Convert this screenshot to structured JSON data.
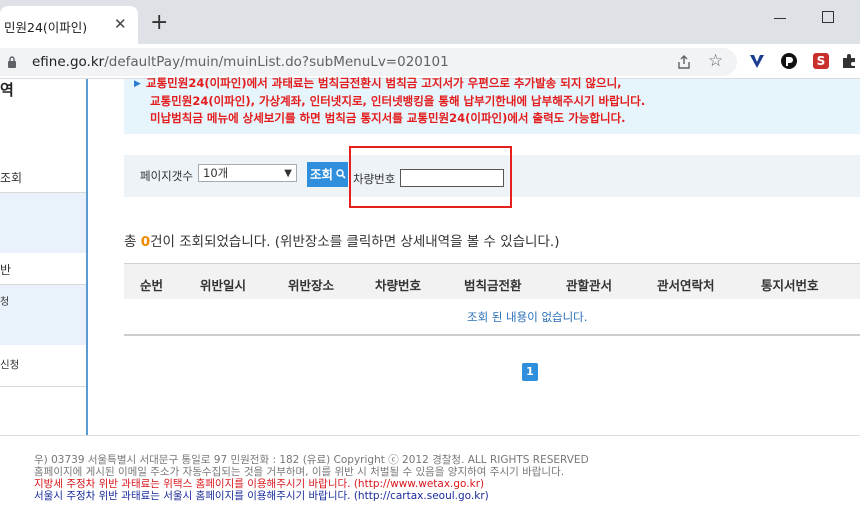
{
  "browser": {
    "tab_title": "민원24(이파인)",
    "tab_close": "✕",
    "new_tab": "+",
    "url_host": "efine.go.kr",
    "url_path": "/defaultPay/muin/muinList.do?subMenuLv=020101",
    "star": "☆"
  },
  "sidebar": {
    "title": "역",
    "items": [
      "조회",
      "반",
      "청",
      "신청"
    ]
  },
  "notice": {
    "line1": "교통민원24(이파인)에서 과태료는 범칙금전환시 범칙금 고지서가 우편으로 추가발송 되지 않으니,",
    "line2": "교통민원24(이파인), 가상계좌, 인터넷지로, 인터넷뱅킹을 통해 납부기한내에 납부해주시기 바랍니다.",
    "line3": "미납범칙금 메뉴에 상세보기를 하면 범칙금 통지서를 교통민원24(이파인)에서 출력도 가능합니다.",
    "arrow": "▶"
  },
  "search": {
    "page_count_label": "페이지갯수",
    "page_count_value": "10개",
    "search_button": "조회",
    "car_number_label": "차량번호",
    "car_number_value": ""
  },
  "result": {
    "prefix": "총 ",
    "count": "0",
    "suffix": "건이 조회되었습니다. (위반장소를 클릭하면 상세내역을 볼 수 있습니다.)"
  },
  "table": {
    "columns": [
      "순번",
      "위반일시",
      "위반장소",
      "차량번호",
      "범칙금전환",
      "관할관서",
      "관서연락처",
      "통지서번호"
    ],
    "empty_message": "조회 된 내용이 없습니다."
  },
  "pagination": {
    "current": "1"
  },
  "footer": {
    "line1": "우) 03739 서울특별시 서대문구 통일로 97   민원전화 : 182 (유료)        Copyright ⓒ 2012 경찰청. ALL RIGHTS RESERVED",
    "line2": "홈페이지에 게시된 이메일 주소가 자동수집되는 것을 거부하며, 이를 위반 시 처벌될 수 있음을 양지하여 주시기 바랍니다.",
    "line3": "지방세 주정차 위반 과태료는 위택스 홈페이지를 이용해주시기 바랍니다. (http://www.wetax.go.kr)",
    "line4": "서울시 주정차 위반 과태료는 서울시 홈페이지를 이용해주시기 바랍니다. (http://cartax.seoul.go.kr)"
  },
  "colors": {
    "accent_blue": "#2f8fdc",
    "notice_red": "#e31d1d",
    "highlight_red": "#e8201c",
    "count_orange": "#f08a00"
  }
}
